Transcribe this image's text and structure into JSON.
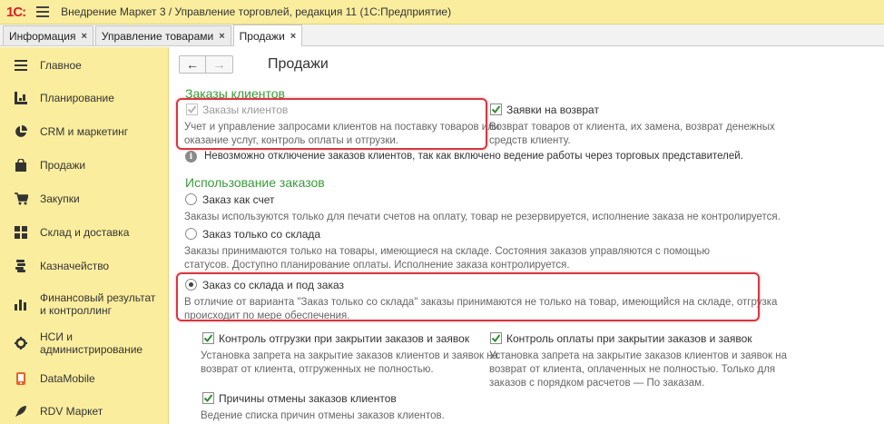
{
  "app": {
    "logo": "1С:",
    "window_title": "Внедрение Маркет 3 / Управление торговлей, редакция 11  (1С:Предприятие)"
  },
  "tabs": [
    {
      "label": "Информация",
      "close": "×"
    },
    {
      "label": "Управление товарами",
      "close": "×"
    },
    {
      "label": "Продажи",
      "close": "×",
      "active": true
    }
  ],
  "sidebar": {
    "items": [
      {
        "label": "Главное",
        "icon": "menu-lines-icon"
      },
      {
        "label": "Планирование",
        "icon": "planning-icon"
      },
      {
        "label": "CRM и маркетинг",
        "icon": "pie-chart-icon"
      },
      {
        "label": "Продажи",
        "icon": "shopping-bag-icon"
      },
      {
        "label": "Закупки",
        "icon": "cart-icon"
      },
      {
        "label": "Склад и доставка",
        "icon": "warehouse-grid-icon"
      },
      {
        "label": "Казначейство",
        "icon": "coins-stack-icon"
      },
      {
        "label": "Финансовый результат и контроллинг",
        "icon": "bar-chart-icon"
      },
      {
        "label": "НСИ и администрирование",
        "icon": "gear-icon"
      },
      {
        "label": "DataMobile",
        "icon": "datamobile-icon"
      },
      {
        "label": "RDV Маркет",
        "icon": "rocket-icon"
      }
    ]
  },
  "content": {
    "nav": {
      "back": "←",
      "forward": "→"
    },
    "page_title": "Продажи",
    "client_orders": {
      "section_title": "Заказы клиентов",
      "orders_label": "Заказы клиентов",
      "orders_desc_1": "Учет и управление запросами клиентов на поставку товаров или",
      "orders_desc_2": "оказание услуг, контроль оплаты и отгрузки.",
      "returns_label": "Заявки на возврат",
      "returns_desc_1": "Возврат товаров от клиента, их замена, возврат денежных",
      "returns_desc_2": "средств клиенту.",
      "info_icon": "i",
      "info_text": "Невозможно отключение заказов клиентов, так как включено ведение работы через торговых представителей."
    },
    "order_usage": {
      "section_title": "Использование заказов",
      "opt1_label": "Заказ как счет",
      "opt1_desc": "Заказы используются только для печати счетов на оплату, товар не резервируется, исполнение заказа не контролируется.",
      "opt2_label": "Заказ только со склада",
      "opt2_desc_1": "Заказы принимаются только на товары, имеющиеся на складе. Состояния заказов управляются с помощью",
      "opt2_desc_2": "статусов. Доступно планирование оплаты. Исполнение заказа контролируется.",
      "opt3_label": "Заказ со склада и под заказ",
      "opt3_desc_1": "В отличие от варианта \"Заказ только со склада\" заказы принимаются не только на товар, имеющийся на складе, отгрузка",
      "opt3_desc_2": "происходит по мере обеспечения.",
      "shipment_control_label": "Контроль отгрузки при закрытии заказов и заявок",
      "shipment_control_desc_1": "Установка запрета на закрытие заказов клиентов и заявок на",
      "shipment_control_desc_2": "возврат от клиента, отгруженных не полностью.",
      "payment_control_label": "Контроль оплаты при закрытии заказов и заявок",
      "payment_control_desc_1": "Установка запрета на закрытие заказов клиентов и заявок на",
      "payment_control_desc_2": "возврат от клиента, оплаченных не полностью. Только для",
      "payment_control_desc_3": "заказов с порядком расчетов — По заказам.",
      "cancel_reasons_label": "Причины отмены заказов клиентов",
      "cancel_reasons_desc": "Ведение списка причин отмены заказов клиентов."
    }
  },
  "colors": {
    "panel_yellow": "#fbed9e",
    "section_green": "#3a9a3a",
    "highlight_red": "#d9373f",
    "check_green": "#2f8f2f"
  }
}
